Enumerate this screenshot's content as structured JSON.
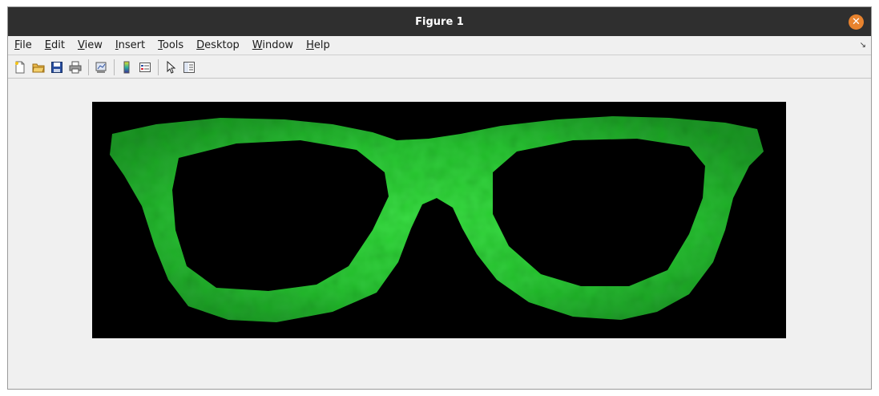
{
  "window": {
    "title": "Figure 1",
    "close_icon": "close-icon",
    "accent_color": "#e8832e"
  },
  "menubar": {
    "items": [
      {
        "label": "File",
        "mnemonic": "F"
      },
      {
        "label": "Edit",
        "mnemonic": "E"
      },
      {
        "label": "View",
        "mnemonic": "V"
      },
      {
        "label": "Insert",
        "mnemonic": "I"
      },
      {
        "label": "Tools",
        "mnemonic": "T"
      },
      {
        "label": "Desktop",
        "mnemonic": "D"
      },
      {
        "label": "Window",
        "mnemonic": "W"
      },
      {
        "label": "Help",
        "mnemonic": "H"
      }
    ],
    "dock_icon": "dock-arrow-icon"
  },
  "toolbar": {
    "buttons": [
      {
        "icon": "new-figure-icon"
      },
      {
        "icon": "open-file-icon"
      },
      {
        "icon": "save-icon"
      },
      {
        "icon": "print-icon"
      },
      {
        "icon": "link-plot-icon"
      },
      {
        "icon": "colorbar-icon"
      },
      {
        "icon": "legend-icon"
      },
      {
        "icon": "edit-plot-pointer-icon"
      },
      {
        "icon": "property-inspector-icon"
      }
    ]
  },
  "figure": {
    "image_description_colors": {
      "background": "#000000",
      "frame": "#2ecc40"
    }
  }
}
